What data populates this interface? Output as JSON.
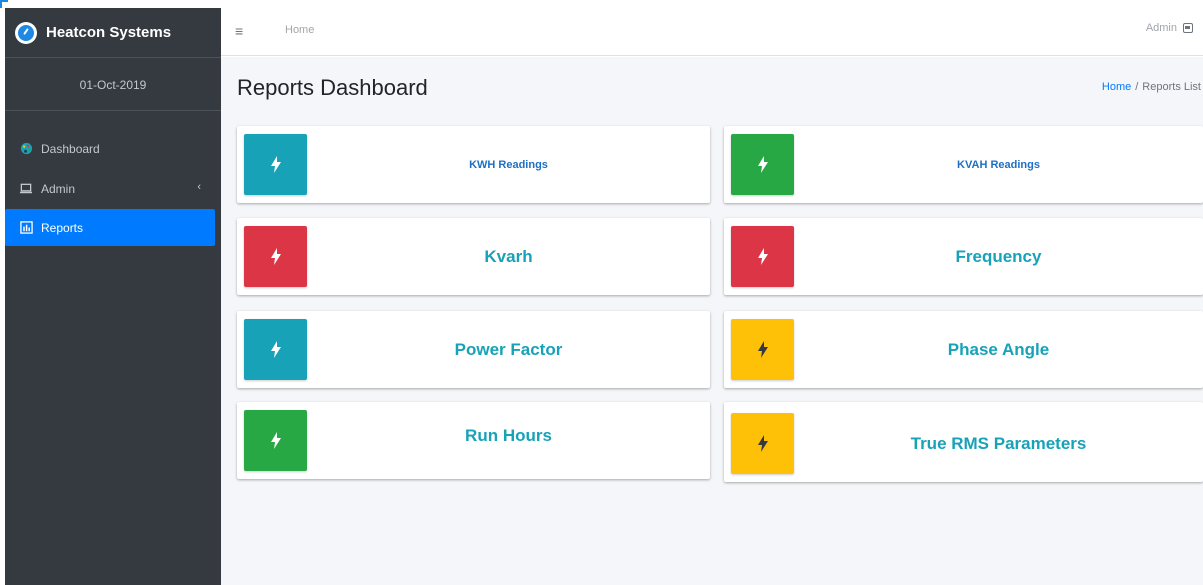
{
  "brand": {
    "name": "Heatcon Systems",
    "logo_icon": "compass-logo-icon"
  },
  "sidebar": {
    "date": "01-Oct-2019",
    "items": [
      {
        "label": "Dashboard",
        "icon": "palette-icon",
        "active": false
      },
      {
        "label": "Admin",
        "icon": "laptop-icon",
        "has_submenu": true,
        "caret": "‹",
        "active": false
      },
      {
        "label": "Reports",
        "icon": "bar-chart-icon",
        "active": true
      }
    ]
  },
  "header": {
    "menu_icon": "≡",
    "home": "Home",
    "user": "Admin"
  },
  "page": {
    "title": "Reports Dashboard",
    "breadcrumb": {
      "home": "Home",
      "separator": "/",
      "current": "Reports List"
    }
  },
  "cards": [
    {
      "label": "KWH Readings",
      "color": "#17a2b8"
    },
    {
      "label": "KVAH Readings",
      "color": "#28a745"
    },
    {
      "label": "Kvarh",
      "color": "#dc3545"
    },
    {
      "label": "Frequency",
      "color": "#dc3545"
    },
    {
      "label": "Power Factor",
      "color": "#17a2b8"
    },
    {
      "label": "Phase Angle",
      "color": "#ffc107"
    },
    {
      "label": "Run Hours",
      "color": "#28a745"
    },
    {
      "label": "True RMS Parameters",
      "color": "#ffc107"
    }
  ],
  "colors": {
    "sidebar_bg": "#343a40",
    "active_nav": "#007bff",
    "link": "#007bff",
    "card_label": "#17a2b8"
  }
}
